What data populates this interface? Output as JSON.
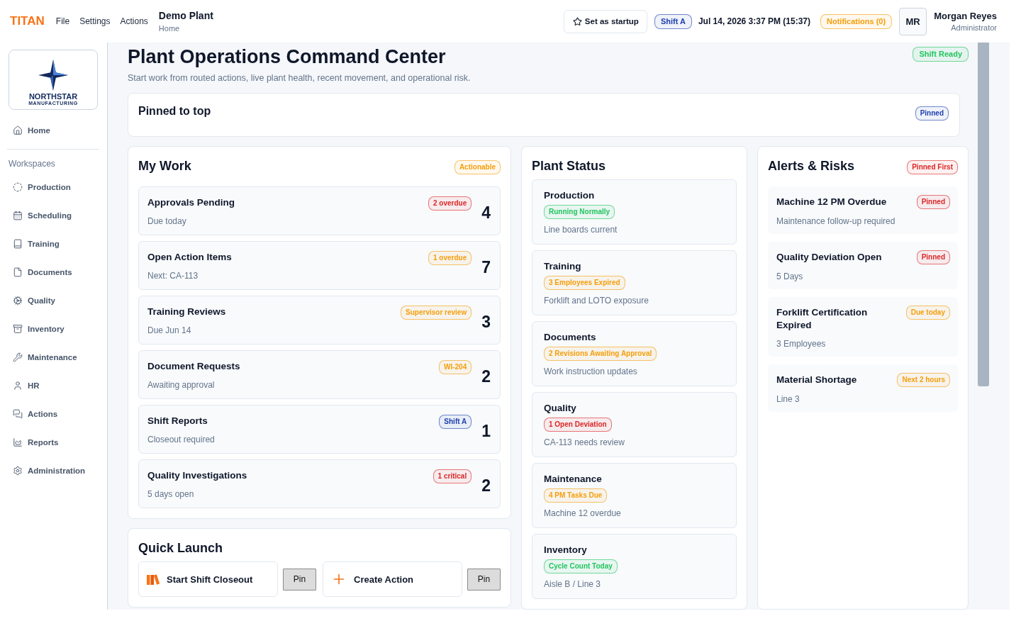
{
  "header": {
    "brand": "TITAN",
    "menu": [
      "File",
      "Settings",
      "Actions"
    ],
    "plant": "Demo Plant",
    "breadcrumb": "Home",
    "startup_button": "Set as startup",
    "shift_badge": {
      "text": "Shift A",
      "color": "#1e40af"
    },
    "datetime": "Jul 14, 2026 3:37 PM (15:37)",
    "notifications_badge": {
      "text": "Notifications (0)",
      "color": "#f59e0b"
    },
    "user": {
      "initials": "MR",
      "name": "Morgan Reyes",
      "role": "Administrator"
    }
  },
  "sidebar": {
    "logo": {
      "name": "NORTHSTAR",
      "tagline": "MANUFACTURING"
    },
    "home": {
      "label": "Home",
      "selected": false
    },
    "section_label": "Workspaces",
    "items": [
      {
        "label": "Production",
        "selected": false
      },
      {
        "label": "Scheduling",
        "selected": false
      },
      {
        "label": "Training",
        "selected": false
      },
      {
        "label": "Documents",
        "selected": false
      },
      {
        "label": "Quality",
        "selected": false
      },
      {
        "label": "Inventory",
        "selected": false
      },
      {
        "label": "Maintenance",
        "selected": false
      },
      {
        "label": "HR",
        "selected": false
      },
      {
        "label": "Actions",
        "selected": false
      },
      {
        "label": "Reports",
        "selected": false
      },
      {
        "label": "Administration",
        "selected": false
      }
    ]
  },
  "page": {
    "title": "Plant Operations Command Center",
    "subtitle": "Start work from routed actions, live plant health, recent movement, and operational risk.",
    "status_badge": {
      "text": "Shift Ready",
      "color": "#22c55e"
    }
  },
  "pinned": {
    "title": "Pinned to top",
    "badge": {
      "text": "Pinned",
      "color": "#1e40af"
    }
  },
  "my_work": {
    "title": "My Work",
    "badge": {
      "text": "Actionable",
      "color": "#f59e0b"
    },
    "items": [
      {
        "title": "Approvals Pending",
        "subtitle": "Due today",
        "badge": {
          "text": "2 overdue",
          "color": "#dc2626"
        },
        "count": "4"
      },
      {
        "title": "Open Action Items",
        "subtitle": "Next: CA-113",
        "badge": {
          "text": "1 overdue",
          "color": "#f59e0b"
        },
        "count": "7"
      },
      {
        "title": "Training Reviews",
        "subtitle": "Due Jun 14",
        "badge": {
          "text": "Supervisor review",
          "color": "#f59e0b"
        },
        "count": "3"
      },
      {
        "title": "Document Requests",
        "subtitle": "Awaiting approval",
        "badge": {
          "text": "WI-204",
          "color": "#f59e0b"
        },
        "count": "2"
      },
      {
        "title": "Shift Reports",
        "subtitle": "Closeout required",
        "badge": {
          "text": "Shift A",
          "color": "#1e40af"
        },
        "count": "1"
      },
      {
        "title": "Quality Investigations",
        "subtitle": "5 days open",
        "badge": {
          "text": "1 critical",
          "color": "#dc2626"
        },
        "count": "2"
      }
    ]
  },
  "quick_launch": {
    "title": "Quick Launch",
    "actions": [
      {
        "label": "Start Shift Closeout",
        "pin": "Pin"
      },
      {
        "label": "Create Action",
        "pin": "Pin"
      }
    ]
  },
  "plant_status": {
    "title": "Plant Status",
    "items": [
      {
        "title": "Production",
        "badge": {
          "text": "Running Normally",
          "color": "#22c55e"
        },
        "subtitle": "Line boards current"
      },
      {
        "title": "Training",
        "badge": {
          "text": "3 Employees Expired",
          "color": "#f59e0b"
        },
        "subtitle": "Forklift and LOTO exposure"
      },
      {
        "title": "Documents",
        "badge": {
          "text": "2 Revisions Awaiting Approval",
          "color": "#f59e0b"
        },
        "subtitle": "Work instruction updates"
      },
      {
        "title": "Quality",
        "badge": {
          "text": "1 Open Deviation",
          "color": "#dc2626"
        },
        "subtitle": "CA-113 needs review"
      },
      {
        "title": "Maintenance",
        "badge": {
          "text": "4 PM Tasks Due",
          "color": "#f59e0b"
        },
        "subtitle": "Machine 12 overdue"
      },
      {
        "title": "Inventory",
        "badge": {
          "text": "Cycle Count Today",
          "color": "#22c55e"
        },
        "subtitle": "Aisle B / Line 3"
      }
    ]
  },
  "alerts": {
    "title": "Alerts & Risks",
    "badge": {
      "text": "Pinned First",
      "color": "#dc2626"
    },
    "items": [
      {
        "title": "Machine 12 PM Overdue",
        "badge": {
          "text": "Pinned",
          "color": "#dc2626"
        },
        "subtitle": "Maintenance follow-up required"
      },
      {
        "title": "Quality Deviation Open",
        "badge": {
          "text": "Pinned",
          "color": "#dc2626"
        },
        "subtitle": "5 Days"
      },
      {
        "title": "Forklift Certification Expired",
        "badge": {
          "text": "Due today",
          "color": "#f59e0b"
        },
        "subtitle": "3 Employees"
      },
      {
        "title": "Material Shortage",
        "badge": {
          "text": "Next 2 hours",
          "color": "#f59e0b"
        },
        "subtitle": "Line 3"
      }
    ]
  }
}
